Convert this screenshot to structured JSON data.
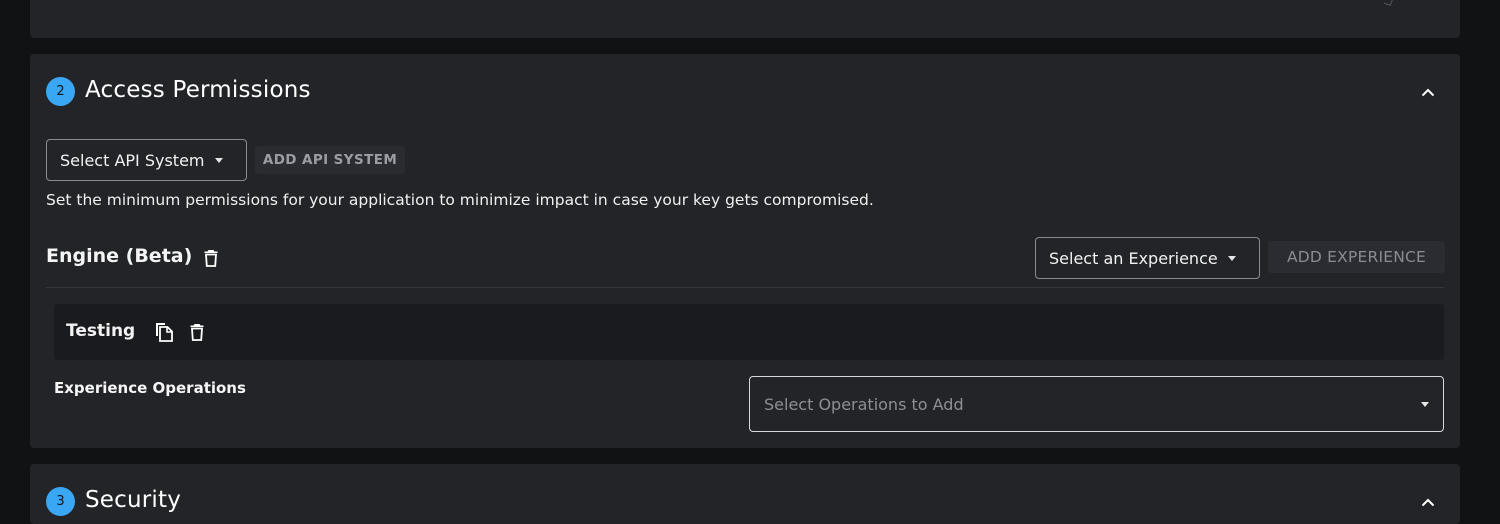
{
  "access_section": {
    "step": "2",
    "title": "Access Permissions",
    "api_system_select": "Select API System",
    "add_api_system_label": "ADD API SYSTEM",
    "description": "Set the minimum permissions for your application to minimize impact in case your key gets compromised.",
    "engine": {
      "title": "Engine (Beta)",
      "experience_select": "Select an Experience",
      "add_experience_label": "ADD EXPERIENCE",
      "experience": {
        "name": "Testing",
        "operations_label": "Experience Operations",
        "operations_placeholder": "Select Operations to Add"
      }
    }
  },
  "security_section": {
    "step": "3",
    "title": "Security"
  },
  "icons": {
    "collapse": "chevron-up-icon",
    "delete": "trash-icon",
    "copy": "copy-icon",
    "dropdown": "caret-down-icon"
  },
  "colors": {
    "accent": "#3aa7f5",
    "panel_bg": "#232428",
    "page_bg": "#111214",
    "card_bg": "#1a1b1e"
  }
}
